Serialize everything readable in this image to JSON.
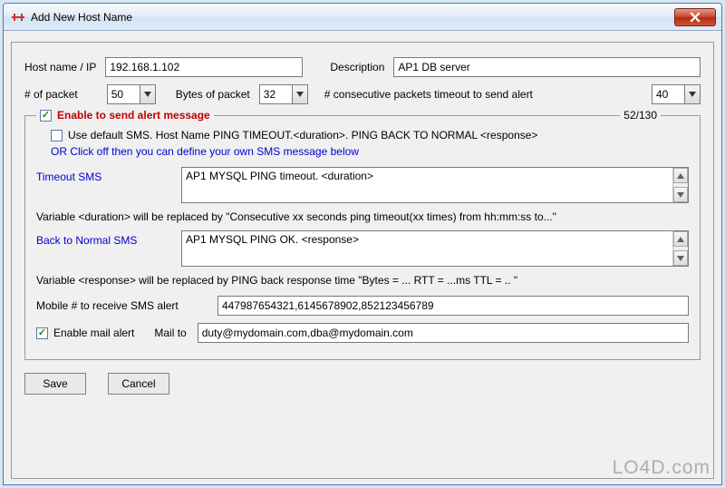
{
  "window": {
    "title": "Add New Host Name"
  },
  "row1": {
    "hostname_lbl": "Host name / IP",
    "hostname_val": "192.168.1.102",
    "desc_lbl": "Description",
    "desc_val": "AP1 DB server"
  },
  "row2": {
    "num_packet_lbl": "# of packet",
    "num_packet_val": "50",
    "bytes_lbl": "Bytes of packet",
    "bytes_val": "32",
    "consec_lbl": "# consecutive packets timeout to send alert",
    "consec_val": "40"
  },
  "group": {
    "enable_alert_lbl": "Enable to send alert message",
    "counter": "52/130",
    "default_sms_lbl": "Use default SMS. Host Name PING TIMEOUT.<duration>. PING BACK TO NORMAL <response>",
    "off_msg": "OR Click off then you can define your own SMS message below",
    "timeout_sms_lbl": "Timeout SMS",
    "timeout_sms_val": "AP1 MYSQL PING timeout. <duration>",
    "timeout_hint": "Variable <duration> will be replaced by \"Consecutive xx seconds ping timeout(xx times) from hh:mm:ss to...\"",
    "back_sms_lbl": "Back to Normal SMS",
    "back_sms_val": "AP1 MYSQL PING OK. <response>",
    "back_hint": "Variable <response> will be replaced by PING back response time \"Bytes = ... RTT = ...ms TTL = .. \"",
    "mobile_lbl": "Mobile # to receive SMS alert",
    "mobile_val": "447987654321,6145678902,852123456789",
    "mail_enable_lbl": "Enable mail alert",
    "mail_to_lbl": "Mail to",
    "mail_to_val": "duty@mydomain.com,dba@mydomain.com"
  },
  "buttons": {
    "save": "Save",
    "cancel": "Cancel"
  },
  "brand": "LO4D.com"
}
